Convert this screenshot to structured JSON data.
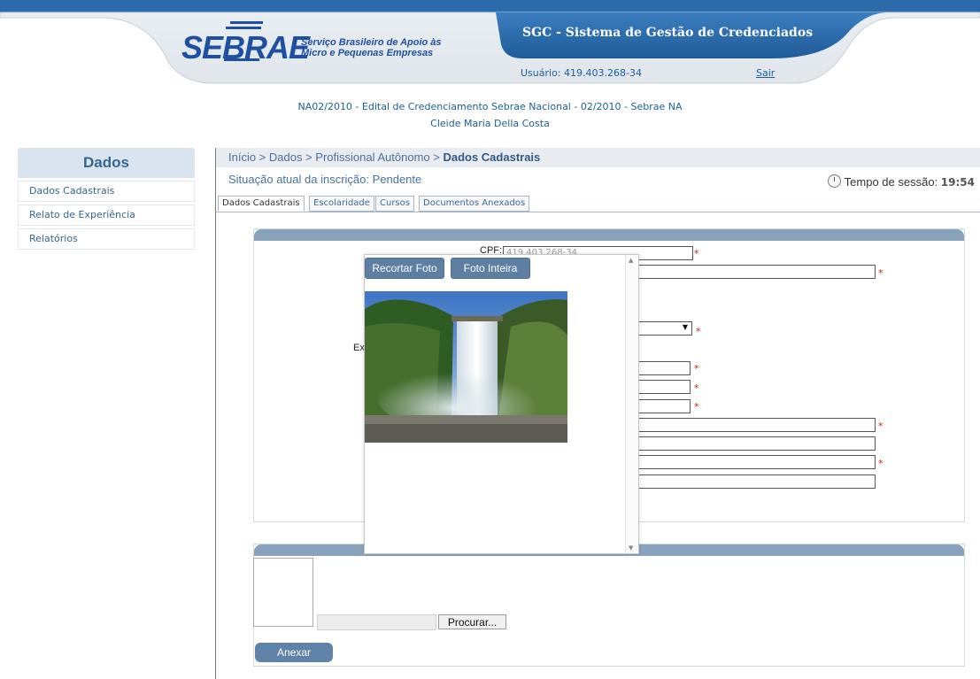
{
  "header": {
    "logo_text": "SEBRAE",
    "logo_tagline_1": "Serviço Brasileiro de Apoio às",
    "logo_tagline_2": "Micro e Pequenas Empresas",
    "system_title": "SGC - Sistema de Gestão de Credenciados",
    "user_label": "Usuário: 419.403.268-34",
    "logout_label": "Sair"
  },
  "edital": {
    "line1": "NA02/2010 - Edital de Credenciamento Sebrae Nacional - 02/2010 - Sebrae NA",
    "line2": "Cleide Maria Della Costa"
  },
  "sidebar": {
    "title": "Dados",
    "items": [
      {
        "label": "Dados Cadastrais"
      },
      {
        "label": "Relato de Experiência"
      },
      {
        "label": "Relatórios"
      }
    ]
  },
  "breadcrumb": {
    "path": "Início > Dados > Profissional Autônomo > ",
    "current": "Dados Cadastrais"
  },
  "status": {
    "text": "Situação atual da inscrição: Pendente",
    "session_label": "Tempo de sessão:",
    "session_time": "19:54"
  },
  "tabs": [
    {
      "label": "Dados Cadastrais",
      "active": true
    },
    {
      "label": "Escolaridade",
      "active": false
    },
    {
      "label": "Cursos",
      "active": false
    },
    {
      "label": "Documentos Anexados",
      "active": false
    }
  ],
  "form": {
    "cpf_label": "CPF:",
    "cpf_value": "419.403.268-34",
    "partial_label": "Ex",
    "required_mark": "*"
  },
  "upload": {
    "browse_label": "Procurar...",
    "attach_label": "Anexar"
  },
  "modal": {
    "crop_label": "Recortar Foto",
    "full_label": "Foto Inteira"
  },
  "colors": {
    "brand_blue": "#1f4fa1",
    "header_blue": "#2d6aab",
    "panel_header": "#8aa3bc",
    "required_red": "#d0211a"
  }
}
